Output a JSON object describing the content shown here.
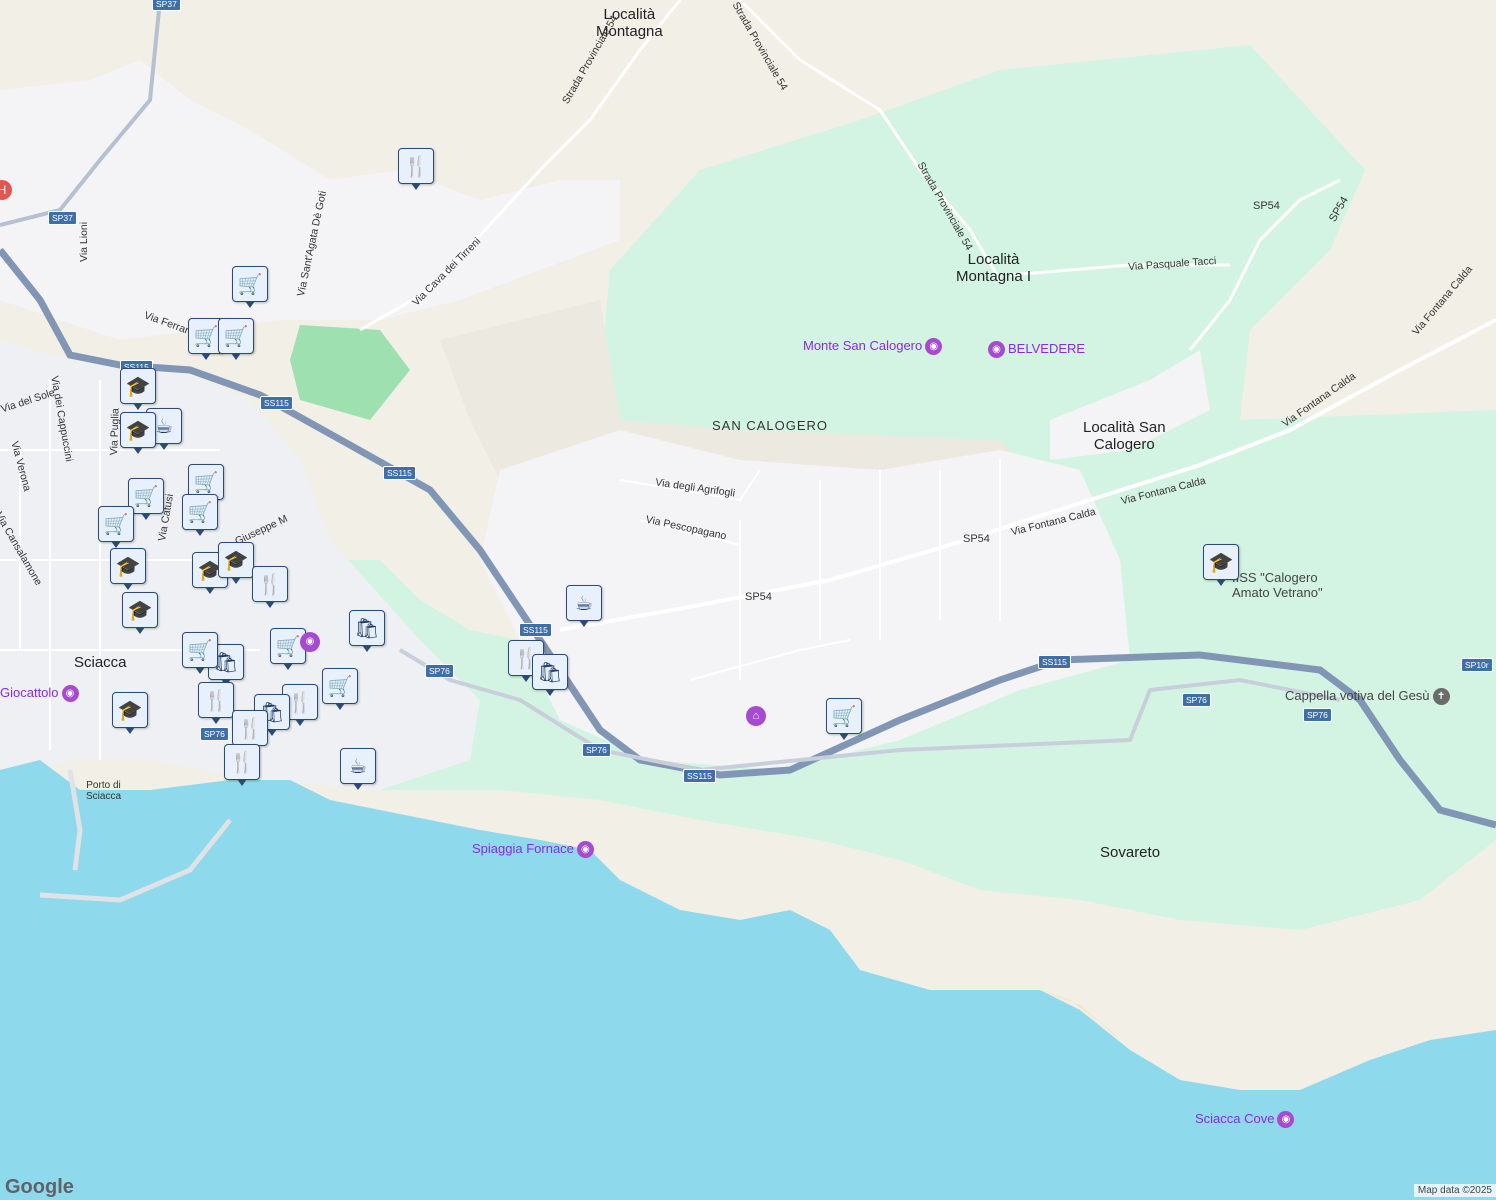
{
  "map": {
    "towns": [
      {
        "id": "localita-montagna",
        "text": "Località\nMontagna"
      },
      {
        "id": "localita-montagna-i",
        "text": "Località\nMontagna I"
      },
      {
        "id": "localita-san-calogero",
        "text": "Località San\nCalogero"
      },
      {
        "id": "sciacca",
        "text": "Sciacca"
      },
      {
        "id": "sovareto",
        "text": "Sovareto"
      },
      {
        "id": "san-calogero",
        "text": "SAN CALOGERO"
      }
    ],
    "streets": [
      "Strada Provinciale 54",
      "Strada Provinciale 54",
      "Strada Provinciale 54",
      "Via Pasquale Tacci",
      "Via Fontana Calda",
      "Via Fontana Calda",
      "Via Fontana Calda",
      "Via Fontana Calda",
      "Via degli Agrifogli",
      "Via Pescopagano",
      "Via Cava dei Tirreni",
      "Via Sant'Agata Dè Goti",
      "Via Lioni",
      "Via Ferraro",
      "Via del Sole",
      "Via dei Cappuccini",
      "Via Puglia",
      "Via Verona",
      "Via Cansalamone",
      "Via Catusi",
      "Via Giuseppe M"
    ],
    "shields": [
      "SP37",
      "SP37",
      "SS115",
      "SS115",
      "SS115",
      "SS115",
      "SS115",
      "SP54",
      "SP54",
      "SP54",
      "SP54",
      "SP76",
      "SP76",
      "SP76",
      "SP76",
      "SP76",
      "SP10r"
    ],
    "pois": [
      {
        "text": "Monte San Calogero",
        "icon": "camera-icon"
      },
      {
        "text": "BELVEDERE",
        "icon": "camera-icon"
      },
      {
        "text": "Spiaggia Fornace",
        "icon": "camera-icon"
      },
      {
        "text": "Sciacca Cove",
        "icon": "camera-icon"
      },
      {
        "text": "Giocattolo",
        "icon": "camera-icon"
      },
      {
        "text": "Cappella votiva del Gesù",
        "icon": "cross-icon"
      },
      {
        "text": "IISS \"Calogero\nAmato Vetrano\"",
        "icon": "school-icon"
      },
      {
        "text": "Porto di\nSciacca",
        "icon": ""
      }
    ],
    "markers": [
      "restaurant-icon",
      "cart-icon",
      "cart-icon",
      "cart-icon",
      "school-icon",
      "coffee-icon",
      "school-icon",
      "cart-icon",
      "cart-icon",
      "cart-icon",
      "cart-icon",
      "school-icon",
      "school-icon",
      "school-icon",
      "restaurant-icon",
      "school-icon",
      "cart-icon",
      "shopping-bag-icon",
      "shopping-bag-icon",
      "restaurant-icon",
      "restaurant-icon",
      "restaurant-icon",
      "cart-icon",
      "cart-icon",
      "restaurant-icon",
      "coffee-icon",
      "coffee-icon",
      "restaurant-icon",
      "shopping-bag-icon",
      "cart-icon",
      "school-icon",
      "school-icon"
    ],
    "colors": {
      "sea": "#8fd9ec",
      "land": "#f1efe6",
      "park": "#d0f5e3",
      "urban": "#f4f4f7",
      "highway": "#8196b5",
      "poi": "#a64bd0",
      "marker": "#1d3a66"
    }
  },
  "attribution": {
    "google": "Google",
    "data": "Map data ©2025"
  }
}
